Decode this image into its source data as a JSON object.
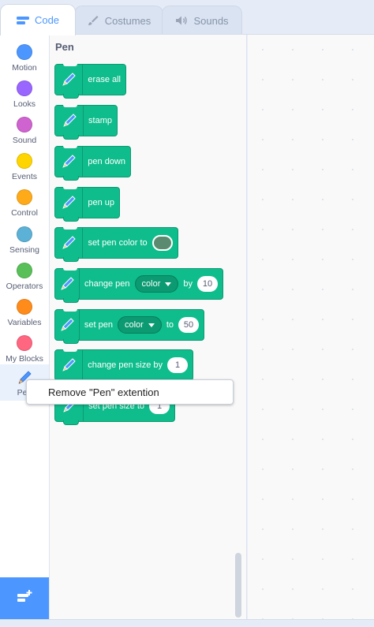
{
  "tabs": {
    "code": "Code",
    "costumes": "Costumes",
    "sounds": "Sounds"
  },
  "categories": [
    {
      "label": "Motion",
      "color": "#4c97ff"
    },
    {
      "label": "Looks",
      "color": "#9966ff"
    },
    {
      "label": "Sound",
      "color": "#cf63cf"
    },
    {
      "label": "Events",
      "color": "#ffd500"
    },
    {
      "label": "Control",
      "color": "#ffab19"
    },
    {
      "label": "Sensing",
      "color": "#5cb1d6"
    },
    {
      "label": "Operators",
      "color": "#59c059"
    },
    {
      "label": "Variables",
      "color": "#ff8c1a"
    },
    {
      "label": "My Blocks",
      "color": "#ff6680"
    },
    {
      "label": "Pen",
      "color": "#0fbd8c"
    }
  ],
  "palette": {
    "title": "Pen",
    "blocks": {
      "erase_all": "erase all",
      "stamp": "stamp",
      "pen_down": "pen down",
      "pen_up": "pen up",
      "set_color_to": "set pen color to",
      "change_pen": "change pen",
      "change_param": "color",
      "change_by": "by",
      "change_value": "10",
      "set_pen": "set pen",
      "set_param": "color",
      "set_to": "to",
      "set_value": "50",
      "change_size": "change pen size by",
      "change_size_value": "1",
      "set_size": "set pen size to",
      "set_size_value": "1"
    }
  },
  "context_menu": {
    "item": "Remove \"Pen\" extention"
  },
  "colors": {
    "accent": "#4c97ff",
    "pen_block": "#0fbd8c",
    "pen_color_swatch": "#5a8a6f"
  }
}
